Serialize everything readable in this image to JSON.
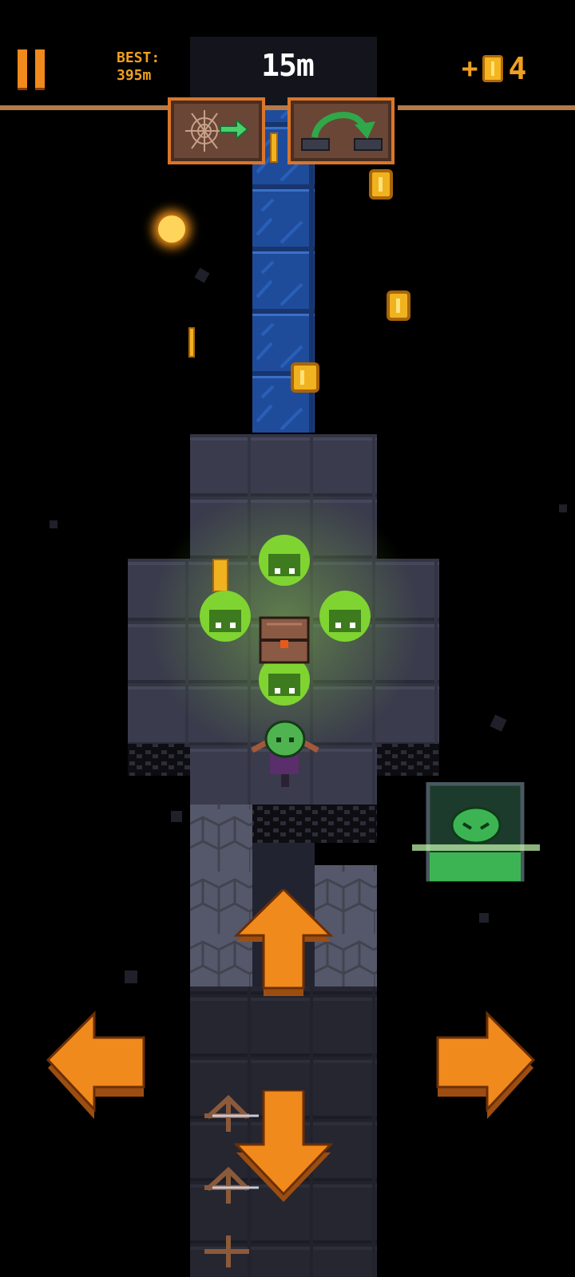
{
  "hud": {
    "pause_icon": "pause-icon",
    "best_label": "BEST:",
    "best_value": "395m",
    "distance": "15m",
    "coin_plus": "+",
    "coin_icon": "coin-icon",
    "coin_count": "4"
  },
  "powerups": [
    {
      "icon": "spiderweb-arrow-icon"
    },
    {
      "icon": "jump-arrow-icon"
    }
  ],
  "player": {
    "icon": "goblin-hero-icon"
  },
  "chest": {
    "icon": "treasure-chest-icon"
  },
  "enemies": [
    {
      "icon": "green-ghost-icon"
    },
    {
      "icon": "green-ghost-icon"
    },
    {
      "icon": "green-ghost-icon"
    },
    {
      "icon": "green-ghost-icon"
    }
  ],
  "side_item": {
    "icon": "green-slime-in-jar-icon"
  },
  "controls": {
    "up": "arrow-up-icon",
    "down": "arrow-down-icon",
    "left": "arrow-left-icon",
    "right": "arrow-right-icon"
  },
  "colors": {
    "accent_orange": "#f08a1c",
    "coin_gold": "#f1b21f",
    "water_blue": "#1f4c9a",
    "floor_gray": "#3a3b4b",
    "ghost_green": "#8fe03a"
  }
}
